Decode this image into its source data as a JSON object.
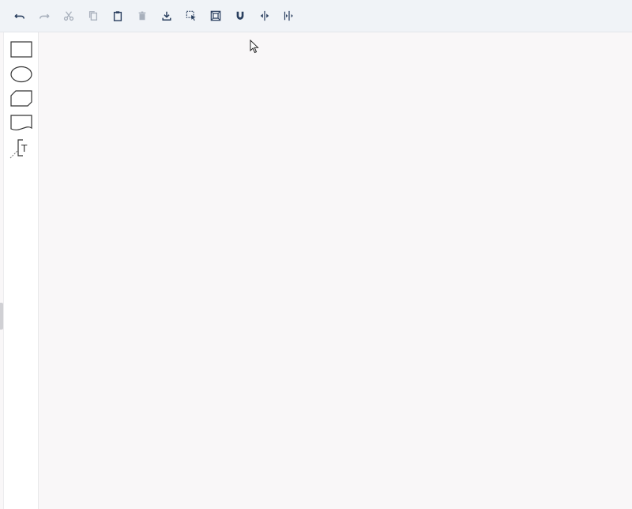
{
  "toolbar": {
    "buttons": [
      {
        "id": "undo",
        "icon": "undo-icon",
        "enabled": true
      },
      {
        "id": "redo",
        "icon": "redo-icon",
        "enabled": false
      },
      {
        "id": "cut",
        "icon": "scissors-icon",
        "enabled": false
      },
      {
        "id": "copy",
        "icon": "copy-icon",
        "enabled": false
      },
      {
        "id": "paste",
        "icon": "clipboard-icon",
        "enabled": true
      },
      {
        "id": "delete",
        "icon": "trash-icon",
        "enabled": false
      },
      {
        "id": "export",
        "icon": "download-icon",
        "enabled": true
      },
      {
        "id": "select",
        "icon": "selection-cursor-icon",
        "enabled": true
      },
      {
        "id": "fit",
        "icon": "fit-frame-icon",
        "enabled": true
      },
      {
        "id": "snap",
        "icon": "magnet-icon",
        "enabled": true
      },
      {
        "id": "distribute-horizontal",
        "icon": "align-horizontal-center-icon",
        "enabled": true
      },
      {
        "id": "distribute-spacing",
        "icon": "distribute-horizontal-icon",
        "enabled": true
      }
    ]
  },
  "palette": {
    "shapes": [
      {
        "id": "rectangle",
        "icon": "rectangle-shape-icon"
      },
      {
        "id": "ellipse",
        "icon": "ellipse-shape-icon"
      },
      {
        "id": "cut-corner",
        "icon": "cut-corner-shape-icon"
      },
      {
        "id": "document",
        "icon": "document-shape-icon"
      },
      {
        "id": "text-annotation",
        "icon": "text-annotation-icon",
        "label": "T"
      }
    ]
  },
  "colors": {
    "toolbar_bg": "#f0f3f7",
    "icon_active": "#2a3f5f",
    "icon_disabled": "#a8b0bc",
    "canvas_bg": "#f9f7f8",
    "palette_bg": "#ffffff",
    "shape_stroke": "#333333"
  }
}
